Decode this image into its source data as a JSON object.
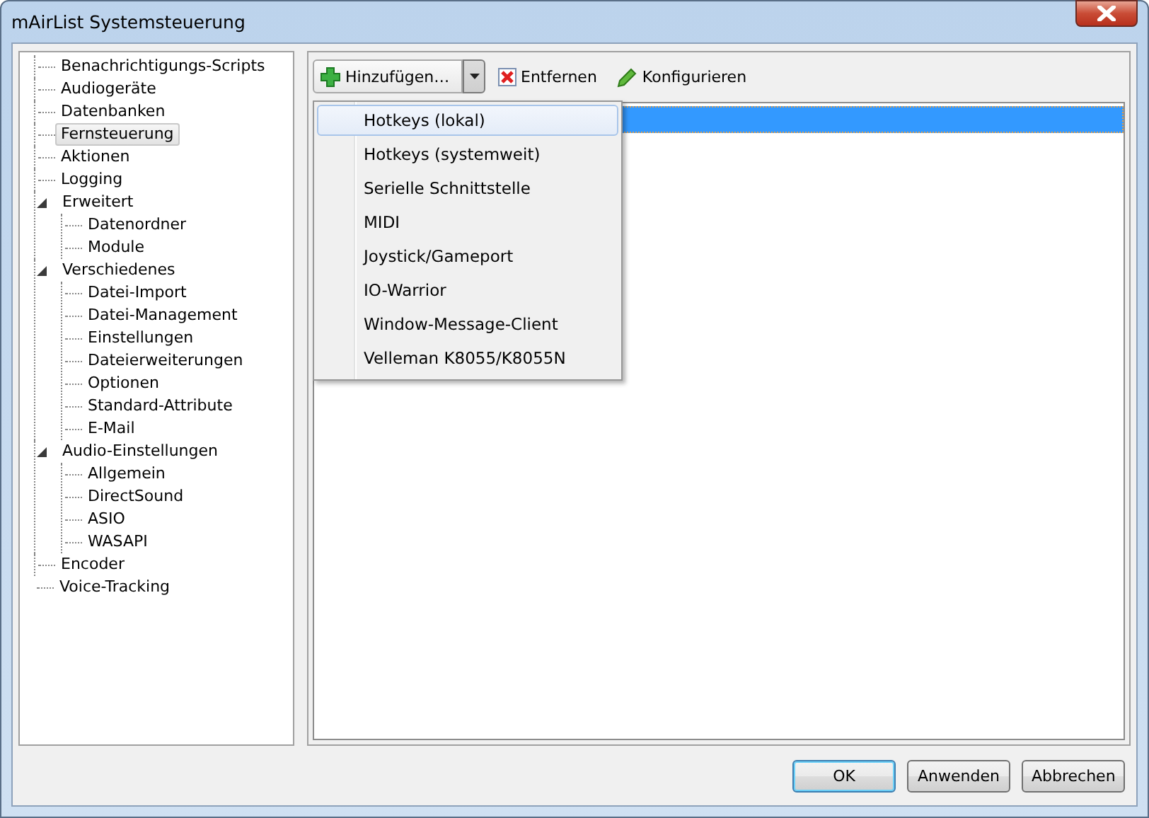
{
  "window": {
    "title": "mAirList Systemsteuerung"
  },
  "tree": [
    {
      "label": "Benachrichtigungs-Scripts",
      "selected": false
    },
    {
      "label": "Audiogeräte",
      "selected": false
    },
    {
      "label": "Datenbanken",
      "selected": false
    },
    {
      "label": "Fernsteuerung",
      "selected": true
    },
    {
      "label": "Aktionen",
      "selected": false
    },
    {
      "label": "Logging",
      "selected": false
    },
    {
      "label": "Erweitert",
      "selected": false,
      "expanded": true,
      "children": [
        {
          "label": "Datenordner",
          "selected": false
        },
        {
          "label": "Module",
          "selected": false
        }
      ]
    },
    {
      "label": "Verschiedenes",
      "selected": false,
      "expanded": true,
      "children": [
        {
          "label": "Datei-Import",
          "selected": false
        },
        {
          "label": "Datei-Management",
          "selected": false
        },
        {
          "label": "Einstellungen",
          "selected": false
        },
        {
          "label": "Dateierweiterungen",
          "selected": false
        },
        {
          "label": "Optionen",
          "selected": false
        },
        {
          "label": "Standard-Attribute",
          "selected": false
        },
        {
          "label": "E-Mail",
          "selected": false
        }
      ]
    },
    {
      "label": "Audio-Einstellungen",
      "selected": false,
      "expanded": true,
      "children": [
        {
          "label": "Allgemein",
          "selected": false
        },
        {
          "label": "DirectSound",
          "selected": false
        },
        {
          "label": "ASIO",
          "selected": false
        },
        {
          "label": "WASAPI",
          "selected": false
        }
      ]
    },
    {
      "label": "Encoder",
      "selected": false
    },
    {
      "label": "Voice-Tracking",
      "selected": false
    }
  ],
  "toolbar": {
    "add": "Hinzufügen…",
    "remove": "Entfernen",
    "configure": "Konfigurieren"
  },
  "list": {
    "rows": [
      {
        "selected": true
      }
    ]
  },
  "menu": [
    {
      "label": "Hotkeys (lokal)",
      "selected": true
    },
    {
      "label": "Hotkeys (systemweit)",
      "selected": false
    },
    {
      "label": "Serielle Schnittstelle",
      "selected": false
    },
    {
      "label": "MIDI",
      "selected": false
    },
    {
      "label": "Joystick/Gameport",
      "selected": false
    },
    {
      "label": "IO-Warrior",
      "selected": false
    },
    {
      "label": "Window-Message-Client",
      "selected": false
    },
    {
      "label": "Velleman K8055/K8055N",
      "selected": false
    }
  ],
  "buttons": [
    {
      "label": "OK",
      "default": true
    },
    {
      "label": "Anwenden",
      "default": false
    },
    {
      "label": "Abbrechen",
      "default": false
    }
  ]
}
